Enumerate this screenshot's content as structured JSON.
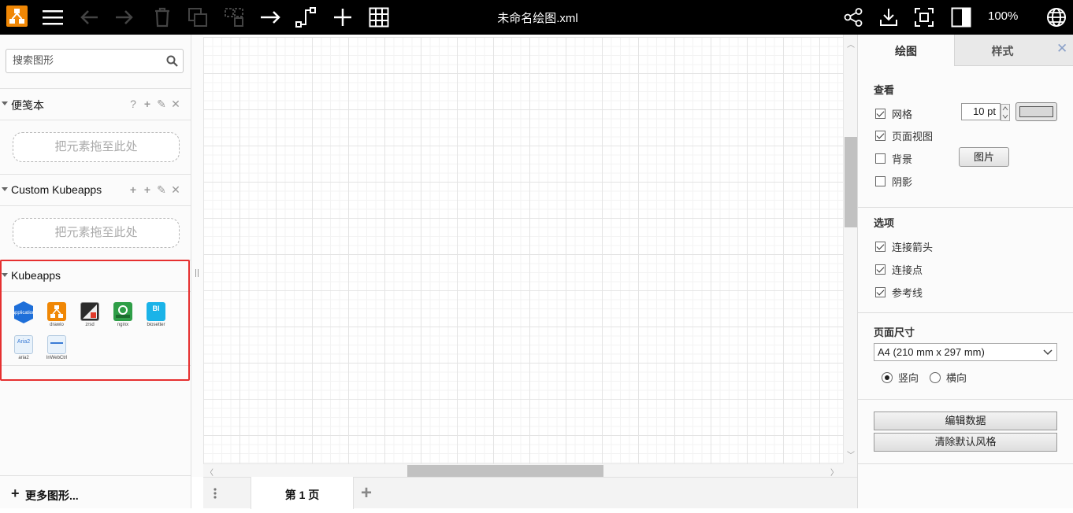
{
  "window": {
    "title": "未命名绘图.xml",
    "zoom": "100%"
  },
  "toolbar": {
    "icons": [
      "drawio-logo-icon",
      "hamburger-menu-icon",
      "undo-icon",
      "redo-icon",
      "delete-icon",
      "to-front-icon",
      "to-back-icon",
      "connector-arrow-icon",
      "waypoints-icon",
      "insert-plus-icon",
      "table-icon",
      "share-icon",
      "export-icon",
      "fullscreen-icon",
      "format-panel-icon",
      "language-globe-icon"
    ]
  },
  "sidebar": {
    "search": {
      "placeholder": "搜索图形",
      "value": ""
    },
    "sections": [
      {
        "title": "便笺本",
        "actions": [
          "?",
          "+",
          "✎",
          "✕"
        ],
        "dropzone": "把元素拖至此处"
      },
      {
        "title": "Custom Kubeapps",
        "actions": [
          "+",
          "+",
          "✎",
          "✕"
        ],
        "dropzone": "把元素拖至此处"
      },
      {
        "title": "Kubeapps"
      }
    ],
    "kubeapps_shapes": [
      {
        "label": "",
        "name": "application",
        "color": "#1e6fd9"
      },
      {
        "label": "drawio",
        "name": "drawio",
        "color": "#f08705"
      },
      {
        "label": "zrsd",
        "name": "zrsd",
        "color": "#2b2b2b"
      },
      {
        "label": "nginx",
        "name": "nginx",
        "color": "#2e9e47"
      },
      {
        "label": "biosetter",
        "name": "biosetter",
        "color": "#1ab3e8"
      },
      {
        "label": "aria2",
        "name": "aria2",
        "color": "#e8f2fb"
      },
      {
        "label": "InWebCtrl",
        "name": "inwebctrl",
        "color": "#e8f2fb"
      }
    ],
    "icon_text": {
      "application": "application",
      "biosetter": "BI",
      "aria2": "Aria2"
    },
    "more_shapes": "更多图形..."
  },
  "pages": {
    "current_tab": "第 1 页",
    "add": "+"
  },
  "format_panel": {
    "tabs": [
      "绘图",
      "样式"
    ],
    "view": {
      "title": "查看",
      "grid": {
        "label": "网格",
        "checked": true,
        "size": "10 pt"
      },
      "page_view": {
        "label": "页面视图",
        "checked": true
      },
      "background": {
        "label": "背景",
        "checked": false,
        "button": "图片"
      },
      "shadow": {
        "label": "阴影",
        "checked": false
      }
    },
    "options": {
      "title": "选项",
      "connection_arrows": {
        "label": "连接箭头",
        "checked": true
      },
      "connection_points": {
        "label": "连接点",
        "checked": true
      },
      "guides": {
        "label": "参考线",
        "checked": true
      }
    },
    "paper_size": {
      "title": "页面尺寸",
      "selected": "A4 (210 mm x 297 mm)",
      "portrait": "竖向",
      "landscape": "横向",
      "orientation": "portrait"
    },
    "buttons": {
      "edit_data": "编辑数据",
      "clear_default_style": "清除默认风格"
    }
  },
  "colors": {
    "toolbar_bg": "#000000",
    "highlight_border": "#e63030",
    "accent": "#f08705"
  }
}
